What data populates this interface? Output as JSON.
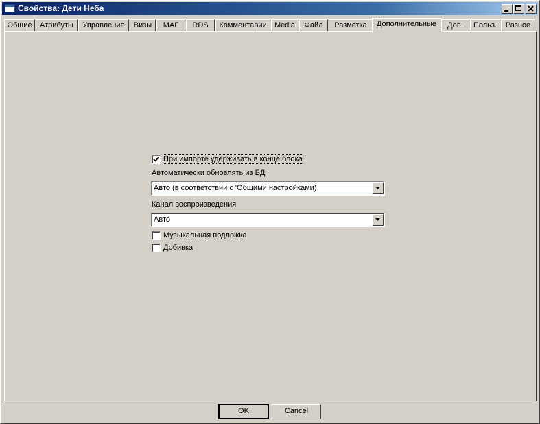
{
  "window": {
    "title": "Свойства: Дети Неба"
  },
  "tabs": [
    {
      "label": "Общие"
    },
    {
      "label": "Атрибуты"
    },
    {
      "label": "Управление"
    },
    {
      "label": "Визы"
    },
    {
      "label": "МАГ"
    },
    {
      "label": "RDS"
    },
    {
      "label": "Комментарии"
    },
    {
      "label": "Media"
    },
    {
      "label": "Файл"
    },
    {
      "label": "Разметка"
    },
    {
      "label": "Дополнительные",
      "active": true
    },
    {
      "label": "Доп."
    },
    {
      "label": "Польз."
    },
    {
      "label": "Разное"
    }
  ],
  "form": {
    "hold_at_block_end": {
      "label": "При импорте удерживать в конце блока",
      "checked": true
    },
    "auto_update": {
      "label": "Автоматически обновлять из БД",
      "value": "Авто (в соответствии с 'Общими настройками)"
    },
    "playback_channel": {
      "label": "Канал воспроизведения",
      "value": "Авто"
    },
    "music_bed": {
      "label": "Музыкальная подложка",
      "checked": false
    },
    "filler": {
      "label": "Добивка",
      "checked": false
    }
  },
  "buttons": {
    "ok": "OK",
    "cancel": "Cancel"
  },
  "icons": {
    "app": "window-icon",
    "minimize": "minimize-icon",
    "maximize": "maximize-icon",
    "close": "close-icon",
    "dropdown": "chevron-down-icon",
    "check": "checkmark-icon"
  }
}
